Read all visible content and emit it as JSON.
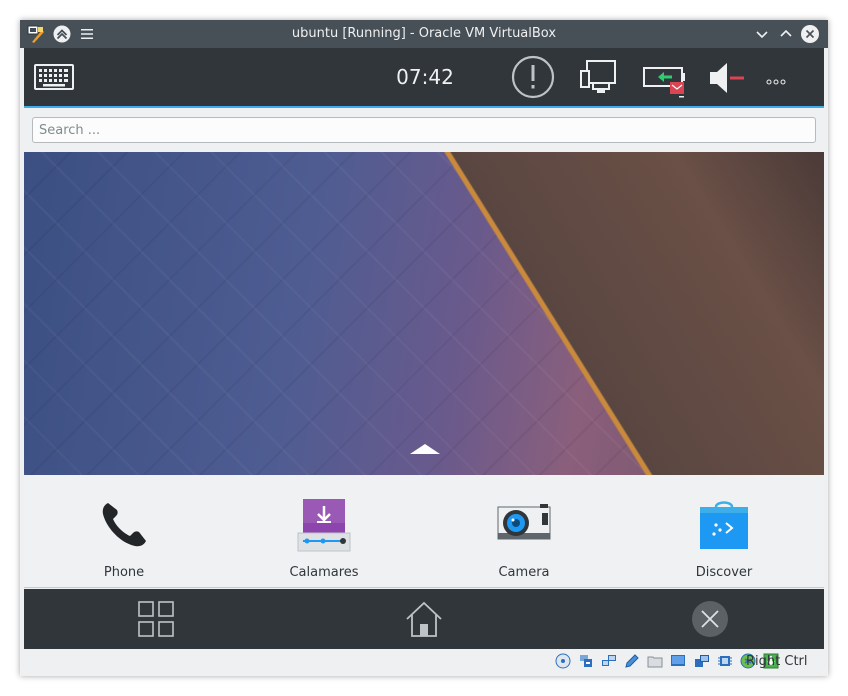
{
  "window": {
    "title": "ubuntu [Running] - Oracle VM VirtualBox"
  },
  "top_panel": {
    "clock": "07:42",
    "icons": [
      "keyboard-icon",
      "notification-alert-icon",
      "network-wired-icon",
      "battery-icon",
      "volume-muted-icon",
      "more-dots-icon"
    ]
  },
  "search": {
    "placeholder": "Search ..."
  },
  "favorites": [
    {
      "label": "Phone",
      "icon": "phone-icon"
    },
    {
      "label": "Calamares",
      "icon": "calamares-installer-icon"
    },
    {
      "label": "Camera",
      "icon": "camera-icon"
    },
    {
      "label": "Discover",
      "icon": "discover-bag-icon"
    }
  ],
  "nav_panel": {
    "icons": [
      "app-grid-icon",
      "home-icon",
      "close-task-icon"
    ]
  },
  "status_bar": {
    "host_key": "Right Ctrl",
    "icons": [
      "optical-disk-icon",
      "usb-icon",
      "network-icon",
      "pencil-icon",
      "shared-folder-icon",
      "display-icon",
      "video-capture-icon",
      "cpu-icon",
      "vm-state-icon",
      "download-arrow-icon"
    ]
  },
  "colors": {
    "panel": "#31363b",
    "titlebar": "#475057",
    "accent": "#3daee9",
    "alert_red": "#da4453",
    "background": "#eff0f1"
  }
}
